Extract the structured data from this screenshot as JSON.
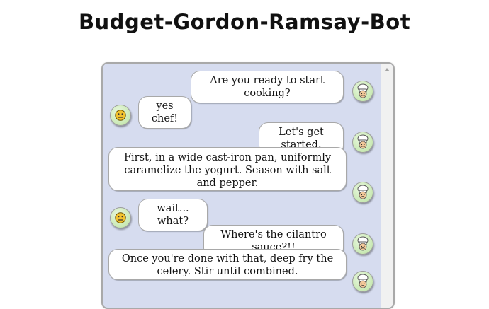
{
  "app": {
    "title": "Budget-Gordon-Ramsay-Bot"
  },
  "chat": {
    "messages": [
      {
        "sender": "bot",
        "text": "Are you ready to start cooking?",
        "avatar_icon": "chef-icon"
      },
      {
        "sender": "user",
        "text": "yes chef!",
        "avatar_icon": "neutral-face-icon"
      },
      {
        "sender": "bot",
        "text": "Let's get started.",
        "avatar_icon": "chef-icon"
      },
      {
        "sender": "bot",
        "text": "First, in a wide cast-iron pan, uniformly caramelize the yogurt. Season with salt and pepper.",
        "avatar_icon": "chef-icon"
      },
      {
        "sender": "user",
        "text": "wait... what?",
        "avatar_icon": "neutral-face-icon"
      },
      {
        "sender": "bot",
        "text": "Where's the cilantro sauce?!!",
        "avatar_icon": "chef-icon"
      },
      {
        "sender": "bot",
        "text": "Once you're done with that, deep fry the celery. Stir until combined.",
        "avatar_icon": "chef-icon"
      }
    ]
  },
  "colors": {
    "chat_background": "#d6dcef",
    "avatar_green": "#c9e9b4",
    "bubble": "#ffffff"
  }
}
